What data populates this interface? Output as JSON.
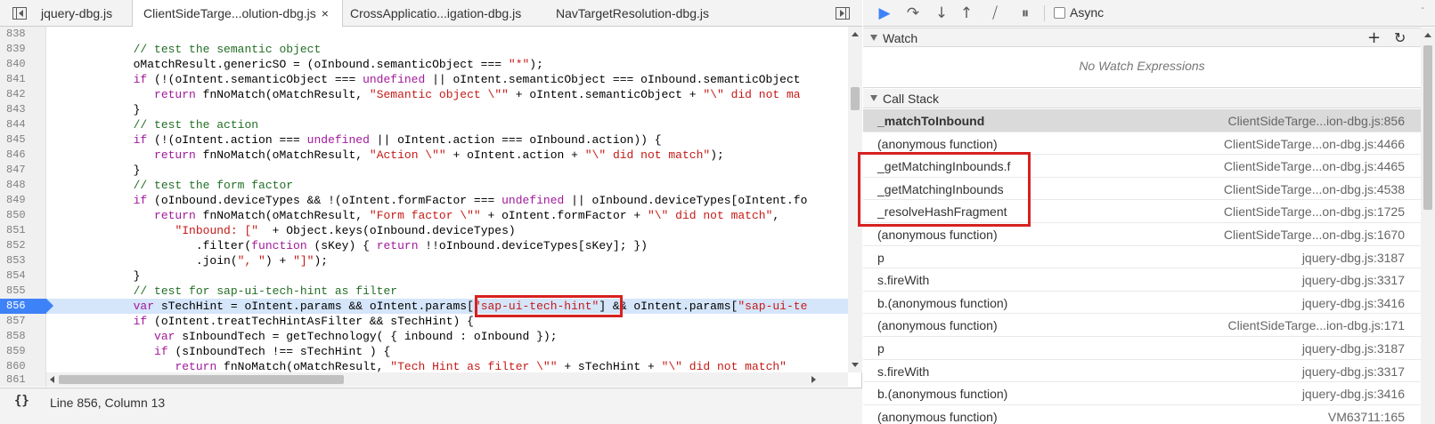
{
  "editor": {
    "tabs": [
      {
        "label": "jquery-dbg.js",
        "active": false
      },
      {
        "label": "ClientSideTarge...olution-dbg.js",
        "active": true,
        "close": "×"
      },
      {
        "label": "CrossApplicatio...igation-dbg.js",
        "active": false
      },
      {
        "label": "NavTargetResolution-dbg.js",
        "active": false
      }
    ],
    "lines": [
      {
        "n": "838",
        "code": ""
      },
      {
        "n": "839",
        "code": "            // test the semantic object"
      },
      {
        "n": "840",
        "code": "            oMatchResult.genericSO = (oInbound.semanticObject === \"*\");"
      },
      {
        "n": "841",
        "code": "            if (!(oIntent.semanticObject === undefined || oIntent.semanticObject === oInbound.semanticObject"
      },
      {
        "n": "842",
        "code": "               return fnNoMatch(oMatchResult, \"Semantic object \\\"\" + oIntent.semanticObject + \"\\\" did not ma"
      },
      {
        "n": "843",
        "code": "            }"
      },
      {
        "n": "844",
        "code": "            // test the action"
      },
      {
        "n": "845",
        "code": "            if (!(oIntent.action === undefined || oIntent.action === oInbound.action)) {"
      },
      {
        "n": "846",
        "code": "               return fnNoMatch(oMatchResult, \"Action \\\"\" + oIntent.action + \"\\\" did not match\");"
      },
      {
        "n": "847",
        "code": "            }"
      },
      {
        "n": "848",
        "code": "            // test the form factor"
      },
      {
        "n": "849",
        "code": "            if (oInbound.deviceTypes && !(oIntent.formFactor === undefined || oInbound.deviceTypes[oIntent.fo"
      },
      {
        "n": "850",
        "code": "               return fnNoMatch(oMatchResult, \"Form factor \\\"\" + oIntent.formFactor + \"\\\" did not match\","
      },
      {
        "n": "851",
        "code": "                  \"Inbound: [\"  + Object.keys(oInbound.deviceTypes)"
      },
      {
        "n": "852",
        "code": "                     .filter(function (sKey) { return !!oInbound.deviceTypes[sKey]; })"
      },
      {
        "n": "853",
        "code": "                     .join(\", \") + \"]\");"
      },
      {
        "n": "854",
        "code": "            }"
      },
      {
        "n": "855",
        "code": "            // test for sap-ui-tech-hint as filter"
      },
      {
        "n": "856",
        "code": "            var sTechHint = oIntent.params && oIntent.params[\"sap-ui-tech-hint\"] && oIntent.params[\"sap-ui-te"
      },
      {
        "n": "857",
        "code": "            if (oIntent.treatTechHintAsFilter && sTechHint) {"
      },
      {
        "n": "858",
        "code": "               var sInboundTech = getTechnology( { inbound : oInbound });"
      },
      {
        "n": "859",
        "code": "               if (sInboundTech !== sTechHint ) {"
      },
      {
        "n": "860",
        "code": "                  return fnNoMatch(oMatchResult, \"Tech Hint as filter \\\"\" + sTechHint + \"\\\" did not match\""
      }
    ],
    "current_line": "856",
    "last_line_number": "861",
    "status": "Line 856, Column 13",
    "status_icon": "{}"
  },
  "debugger": {
    "toolbar": {
      "resume_icon": "▶",
      "step_over_icon": "↷",
      "step_into_icon": "↓",
      "step_out_icon": "↑",
      "deactivate_icon": "⧸",
      "pause_icon": "⏸",
      "async_label": "Async",
      "gripper": "-"
    },
    "watch": {
      "title": "Watch",
      "add": "+",
      "refresh": "↻",
      "empty_text": "No Watch Expressions"
    },
    "call_stack": {
      "title": "Call Stack",
      "frames": [
        {
          "fn": "_matchToInbound",
          "loc": "ClientSideTarge...ion-dbg.js:856",
          "selected": true
        },
        {
          "fn": "(anonymous function)",
          "loc": "ClientSideTarge...on-dbg.js:4466"
        },
        {
          "fn": "_getMatchingInbounds.f",
          "loc": "ClientSideTarge...on-dbg.js:4465"
        },
        {
          "fn": "_getMatchingInbounds",
          "loc": "ClientSideTarge...on-dbg.js:4538"
        },
        {
          "fn": "_resolveHashFragment",
          "loc": "ClientSideTarge...on-dbg.js:1725"
        },
        {
          "fn": "(anonymous function)",
          "loc": "ClientSideTarge...on-dbg.js:1670"
        },
        {
          "fn": "p",
          "loc": "jquery-dbg.js:3187"
        },
        {
          "fn": "s.fireWith",
          "loc": "jquery-dbg.js:3317"
        },
        {
          "fn": "b.(anonymous function)",
          "loc": "jquery-dbg.js:3416"
        },
        {
          "fn": "(anonymous function)",
          "loc": "ClientSideTarge...ion-dbg.js:171"
        },
        {
          "fn": "p",
          "loc": "jquery-dbg.js:3187"
        },
        {
          "fn": "s.fireWith",
          "loc": "jquery-dbg.js:3317"
        },
        {
          "fn": "b.(anonymous function)",
          "loc": "jquery-dbg.js:3416"
        },
        {
          "fn": "(anonymous function)",
          "loc": "VM63711:165"
        }
      ]
    }
  },
  "colors": {
    "highlight_box": "#d62121",
    "current_line_bg": "#d5e5fa",
    "current_line_marker": "#3e82f7",
    "comment": "#236e25",
    "keyword": "#a1199b",
    "string": "#c41a16"
  }
}
